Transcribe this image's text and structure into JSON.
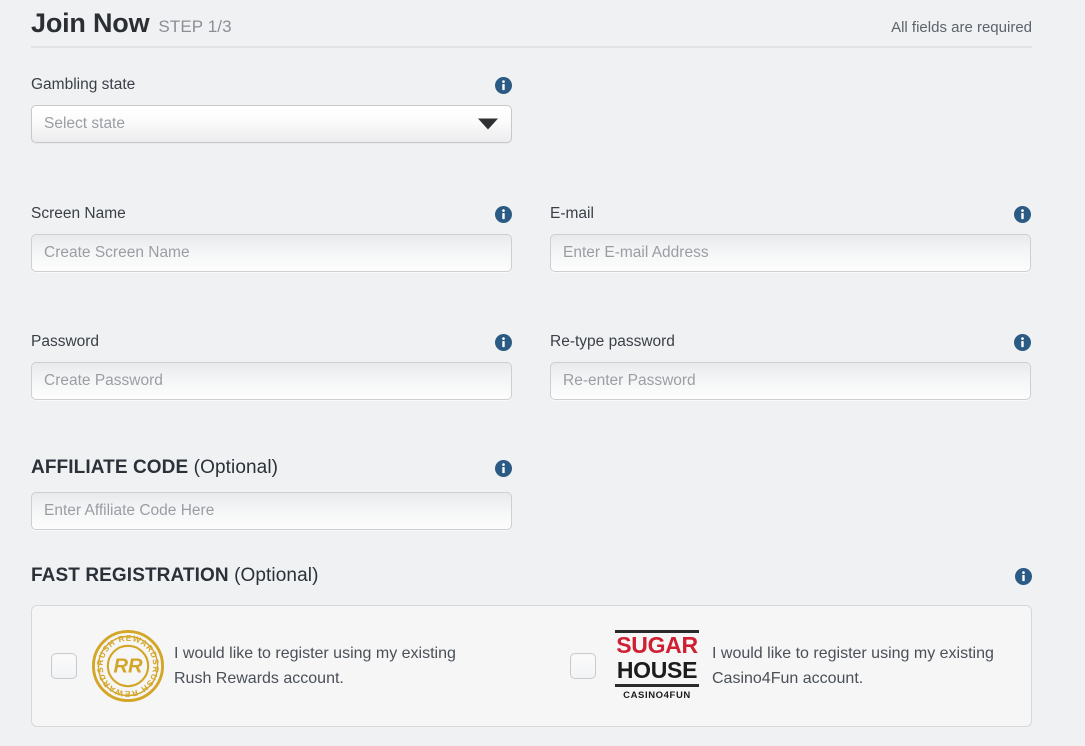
{
  "header": {
    "title": "Join Now",
    "step": "STEP 1/3",
    "required_note": "All fields are required"
  },
  "fields": {
    "gambling_state": {
      "label": "Gambling state",
      "placeholder": "Select state",
      "value": "",
      "info_icon": "info-icon",
      "caret_icon": "chevron-down-icon"
    },
    "screen_name": {
      "label": "Screen Name",
      "placeholder": "Create Screen Name",
      "value": "",
      "info_icon": "info-icon"
    },
    "email": {
      "label": "E-mail",
      "placeholder": "Enter E-mail Address",
      "value": "",
      "info_icon": "info-icon"
    },
    "password": {
      "label": "Password",
      "placeholder": "Create Password",
      "value": "",
      "info_icon": "info-icon"
    },
    "retype_password": {
      "label": "Re-type password",
      "placeholder": "Re-enter Password",
      "value": "",
      "info_icon": "info-icon"
    },
    "affiliate_code": {
      "label_bold": "AFFILIATE CODE",
      "label_light": "(Optional)",
      "placeholder": "Enter Affiliate Code Here",
      "value": "",
      "info_icon": "info-icon"
    }
  },
  "fast_registration": {
    "label_bold": "FAST REGISTRATION",
    "label_light": "(Optional)",
    "info_icon": "info-icon",
    "options": [
      {
        "id": "rush-rewards",
        "checked": false,
        "logo": "rush-rewards-logo",
        "logo_ring_text": "RUSH REWARDS",
        "logo_monogram": "RR",
        "text": "I would like to register using my existing Rush Rewards account."
      },
      {
        "id": "casino4fun",
        "checked": false,
        "logo": "sugarhouse-casino4fun-logo",
        "logo_line1": "SUGAR",
        "logo_line2": "HOUSE",
        "logo_line3": "CASINO4FUN",
        "text": "I would like to register using my existing Casino4Fun account."
      }
    ]
  },
  "colors": {
    "background": "#f0f1f3",
    "title": "#2b2f33",
    "info_blue": "#2b5a84",
    "gold": "#d4a628",
    "sugar_red": "#cf2033"
  }
}
